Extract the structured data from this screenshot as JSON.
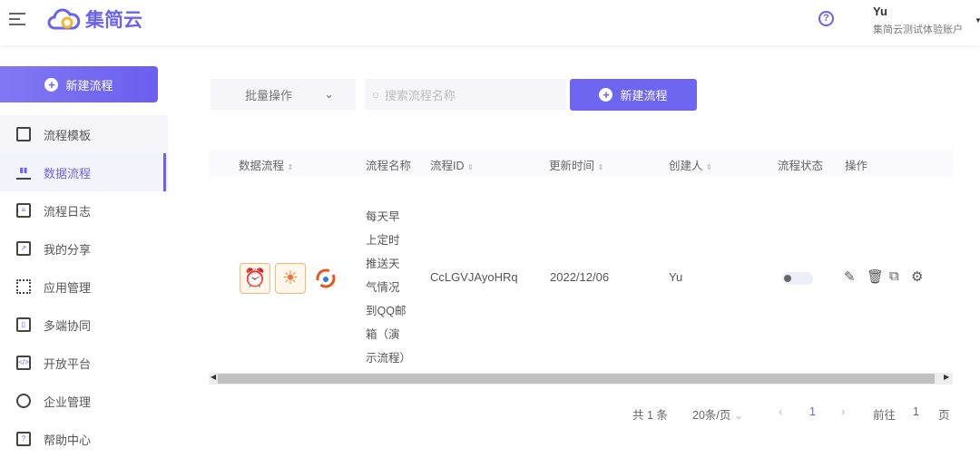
{
  "header": {
    "brand": "集简云",
    "user_name": "Yu",
    "account": "集简云测试体验账户",
    "help": "?"
  },
  "sidebar": {
    "new_button": "新建流程",
    "items": [
      {
        "label": "流程模板",
        "icon": "template-icon"
      },
      {
        "label": "数据流程",
        "icon": "bar-chart-icon"
      },
      {
        "label": "流程日志",
        "icon": "log-icon"
      },
      {
        "label": "我的分享",
        "icon": "share-icon"
      },
      {
        "label": "应用管理",
        "icon": "apps-icon"
      },
      {
        "label": "多端协同",
        "icon": "devices-icon"
      },
      {
        "label": "开放平台",
        "icon": "code-icon"
      },
      {
        "label": "企业管理",
        "icon": "hexagon-icon"
      },
      {
        "label": "帮助中心",
        "icon": "help-icon"
      }
    ]
  },
  "toolbar": {
    "batch": "批量操作",
    "search_placeholder": "搜索流程名称",
    "new_button": "新建流程"
  },
  "table": {
    "columns": [
      "数据流程",
      "流程名称",
      "流程ID",
      "更新时间",
      "创建人",
      "流程状态",
      "操作"
    ],
    "rows": [
      {
        "name": "每天早上定时推送天气情况到QQ邮箱（演示流程）",
        "id": "CcLGVJAyoHRq",
        "updated": "2022/12/06",
        "creator": "Yu",
        "enabled": false
      }
    ]
  },
  "pagination": {
    "total": "共 1 条",
    "page_size": "20条/页",
    "current": "1",
    "goto_label": "前往",
    "goto_value": "1",
    "page_suffix": "页"
  },
  "colors": {
    "accent": "#6b63ee",
    "tile": "#f0712a"
  }
}
